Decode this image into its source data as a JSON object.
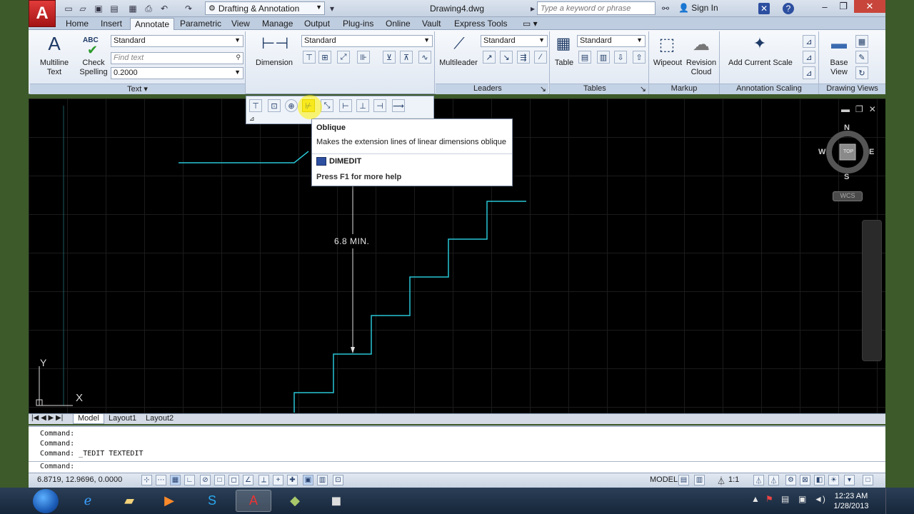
{
  "titlebar": {
    "app_logo": "A",
    "workspace": "Drafting & Annotation",
    "document": "Drawing4.dwg",
    "search_placeholder": "Type a keyword or phrase",
    "sign_in": "Sign In"
  },
  "tabs": [
    "Home",
    "Insert",
    "Annotate",
    "Parametric",
    "View",
    "Manage",
    "Output",
    "Plug-ins",
    "Online",
    "Vault",
    "Express Tools"
  ],
  "active_tab": "Annotate",
  "ribbon": {
    "text_panel": {
      "title": "Text",
      "multiline_text": "Multiline Text",
      "check_spelling": "Check Spelling",
      "abc": "ABC",
      "style": "Standard",
      "find_placeholder": "Find text",
      "height": "0.2000"
    },
    "dimension_panel": {
      "label": "Dimension",
      "style": "Standard"
    },
    "leaders_panel": {
      "title": "Leaders",
      "multileader": "Multileader",
      "style": "Standard"
    },
    "tables_panel": {
      "title": "Tables",
      "table": "Table",
      "style": "Standard"
    },
    "markup_panel": {
      "title": "Markup",
      "wipeout": "Wipeout",
      "revision_cloud": "Revision Cloud"
    },
    "scaling_panel": {
      "title": "Annotation Scaling",
      "add_current_scale": "Add Current Scale"
    },
    "drawing_views_panel": {
      "title": "Drawing Views",
      "base_view": "Base View"
    }
  },
  "tooltip": {
    "title": "Oblique",
    "description": "Makes the extension lines of linear dimensions oblique",
    "command": "DIMEDIT",
    "help": "Press F1 for more help"
  },
  "drawing": {
    "dimension_text": "6.8 MIN.",
    "wcs": "WCS",
    "compass": {
      "n": "N",
      "s": "S",
      "e": "E",
      "w": "W",
      "top": "TOP"
    },
    "ucs_x": "X",
    "ucs_y": "Y",
    "line_color": "#29c6d6"
  },
  "layout_tabs": [
    "Model",
    "Layout1",
    "Layout2"
  ],
  "command_history": [
    "Command:",
    "Command:",
    "Command:  _TEDIT TEXTEDIT"
  ],
  "command_prompt": "Command:",
  "status": {
    "coords": "6.8719, 12.9696, 0.0000",
    "model": "MODEL",
    "scale": "1:1"
  },
  "clock": {
    "time": "12:23 AM",
    "date": "1/28/2013"
  }
}
